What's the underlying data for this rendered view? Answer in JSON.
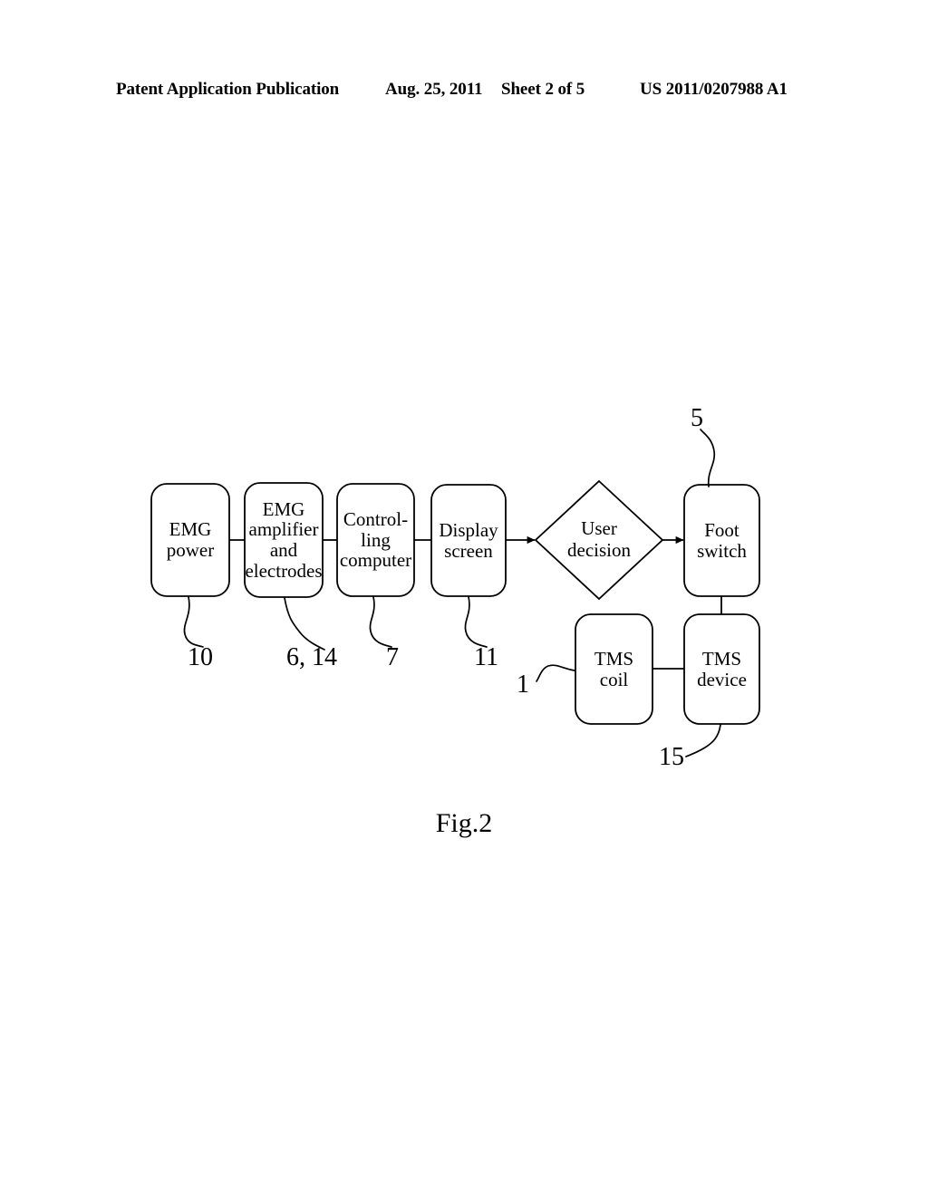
{
  "header": {
    "publication": "Patent Application Publication",
    "date": "Aug. 25, 2011",
    "sheet": "Sheet 2 of 5",
    "patent_number": "US 2011/0207988 A1"
  },
  "figure": {
    "caption": "Fig.2",
    "nodes": [
      {
        "id": "emg-power",
        "label": "EMG\npower",
        "shape": "rounded-rect"
      },
      {
        "id": "emg-amplifier",
        "label": "EMG\namplifier\nand\nelectrodes",
        "shape": "rounded-rect"
      },
      {
        "id": "controlling-computer",
        "label": "Control-\nling\ncomputer",
        "shape": "rounded-rect"
      },
      {
        "id": "display-screen",
        "label": "Display\nscreen",
        "shape": "rounded-rect"
      },
      {
        "id": "user-decision",
        "label": "User\ndecision",
        "shape": "diamond"
      },
      {
        "id": "foot-switch",
        "label": "Foot\nswitch",
        "shape": "rounded-rect"
      },
      {
        "id": "tms-coil",
        "label": "TMS\ncoil",
        "shape": "rounded-rect"
      },
      {
        "id": "tms-device",
        "label": "TMS\ndevice",
        "shape": "rounded-rect"
      }
    ],
    "node_labels": {
      "emg_power_line1": "EMG",
      "emg_power_line2": "power",
      "emg_amplifier_line1": "EMG",
      "emg_amplifier_line2": "amplifier",
      "emg_amplifier_line3": "and",
      "emg_amplifier_line4": "electrodes",
      "controlling_computer_line1": "Control-",
      "controlling_computer_line2": "ling",
      "controlling_computer_line3": "computer",
      "display_screen_line1": "Display",
      "display_screen_line2": "screen",
      "user_decision_line1": "User",
      "user_decision_line2": "decision",
      "foot_switch_line1": "Foot",
      "foot_switch_line2": "switch",
      "tms_coil_line1": "TMS",
      "tms_coil_line2": "coil",
      "tms_device_line1": "TMS",
      "tms_device_line2": "device"
    },
    "reference_numerals": [
      {
        "id": "ref-10",
        "value": "10",
        "points_to": "emg-power"
      },
      {
        "id": "ref-6-14",
        "value": "6, 14",
        "points_to": "emg-amplifier"
      },
      {
        "id": "ref-7",
        "value": "7",
        "points_to": "controlling-computer"
      },
      {
        "id": "ref-11",
        "value": "11",
        "points_to": "display-screen"
      },
      {
        "id": "ref-5",
        "value": "5",
        "points_to": "foot-switch"
      },
      {
        "id": "ref-1",
        "value": "1",
        "points_to": "tms-coil"
      },
      {
        "id": "ref-15",
        "value": "15",
        "points_to": "tms-device"
      }
    ],
    "connections": [
      {
        "from": "emg-power",
        "to": "emg-amplifier",
        "arrow": false
      },
      {
        "from": "emg-amplifier",
        "to": "controlling-computer",
        "arrow": false
      },
      {
        "from": "controlling-computer",
        "to": "display-screen",
        "arrow": false
      },
      {
        "from": "display-screen",
        "to": "user-decision",
        "arrow": true
      },
      {
        "from": "user-decision",
        "to": "foot-switch",
        "arrow": true
      },
      {
        "from": "foot-switch",
        "to": "tms-device",
        "arrow": false
      },
      {
        "from": "tms-device",
        "to": "tms-coil",
        "arrow": false
      }
    ]
  },
  "colors": {
    "ink": "#000000",
    "paper": "#ffffff"
  }
}
